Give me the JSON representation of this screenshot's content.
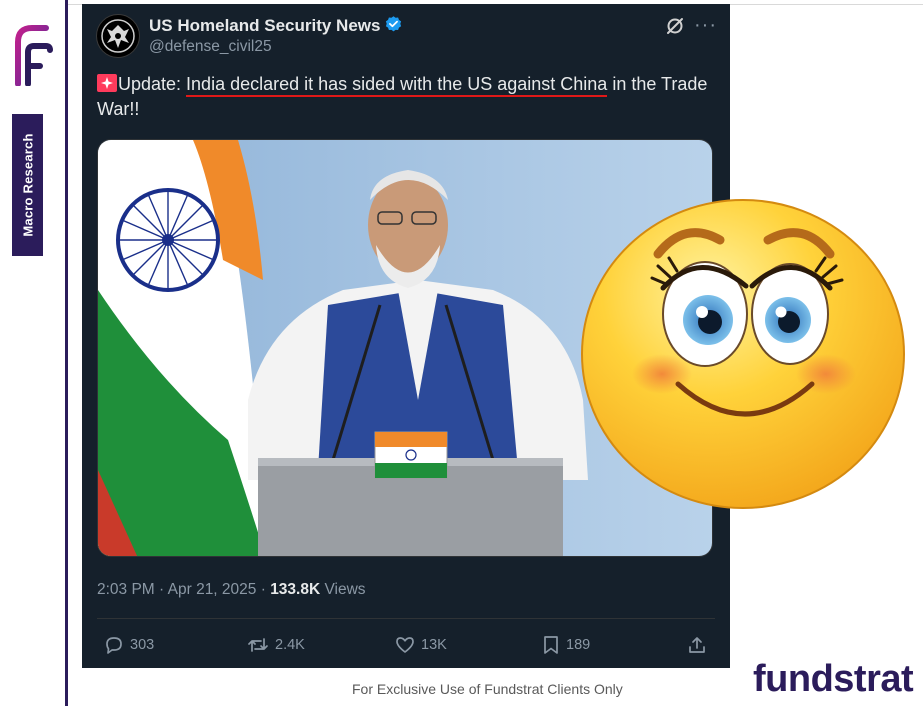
{
  "brand": {
    "side_tag": "Macro Research",
    "logo_text": "fundstrat",
    "footer_note": "For Exclusive Use of Fundstrat Clients Only",
    "colors": {
      "navy": "#2b1c5b",
      "magenta": "#c0208c"
    }
  },
  "tweet": {
    "author_name": "US Homeland Security News",
    "handle": "@defense_civil25",
    "text": {
      "prefix": "Update: ",
      "underlined": "India declared it has sided with the US against China",
      "suffix": " in the Trade War!!"
    },
    "timestamp": "2:03 PM · Apr 21, 2025 · ",
    "views_count": "133.8K",
    "views_label": " Views",
    "actions": {
      "replies": "303",
      "reposts": "2.4K",
      "likes": "13K",
      "bookmarks": "189"
    },
    "icons": [
      "verified-badge-icon",
      "grok-icon",
      "more-icon",
      "reply-icon",
      "repost-icon",
      "like-icon",
      "bookmark-icon",
      "share-icon",
      "siren-emoji-icon"
    ],
    "colors": {
      "background": "#15202b",
      "text": "#e7e9ea",
      "muted": "#8b98a5",
      "verified": "#1d9bf0",
      "underline": "#e01818"
    }
  },
  "overlay": {
    "icon": "smiling-emoji-icon"
  }
}
